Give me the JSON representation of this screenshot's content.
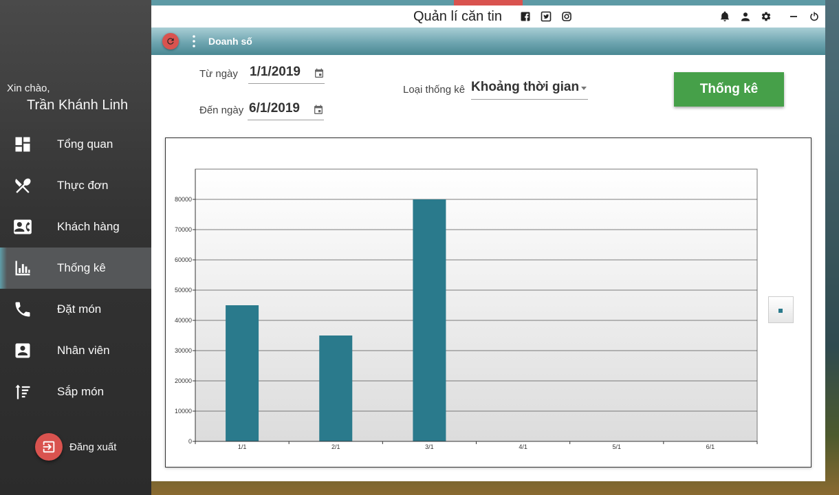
{
  "sidebar": {
    "greeting": "Xin chào,",
    "username": "Trần Khánh Linh",
    "items": [
      {
        "label": "Tổng quan",
        "icon": "dashboard-icon"
      },
      {
        "label": "Thực đơn",
        "icon": "restaurant-icon"
      },
      {
        "label": "Khách hàng",
        "icon": "contact-card-icon"
      },
      {
        "label": "Thống kê",
        "icon": "bar-chart-icon",
        "active": true
      },
      {
        "label": "Đặt món",
        "icon": "phone-icon"
      },
      {
        "label": "Nhân viên",
        "icon": "person-badge-icon"
      },
      {
        "label": "Sắp món",
        "icon": "sort-icon"
      }
    ],
    "logout_label": "Đăng xuất"
  },
  "titlebar": {
    "title": "Quản lí căn tin"
  },
  "toolbar": {
    "title": "Doanh số"
  },
  "form": {
    "from_label": "Từ ngày",
    "from_value": "1/1/2019",
    "to_label": "Đến ngày",
    "to_value": "6/1/2019",
    "type_label": "Loại thống kê",
    "type_value": "Khoảng thời gian",
    "submit_label": "Thống kê"
  },
  "colors": {
    "accent": "#d9534f",
    "bar": "#2a7a8c",
    "button": "#46a049"
  },
  "chart_data": {
    "type": "bar",
    "categories": [
      "1/1",
      "2/1",
      "3/1",
      "4/1",
      "5/1",
      "6/1"
    ],
    "values": [
      45000,
      35000,
      80000,
      0,
      0,
      0
    ],
    "yticks": [
      0,
      10000,
      20000,
      30000,
      40000,
      50000,
      60000,
      70000,
      80000
    ],
    "ylim": [
      0,
      90000
    ],
    "grid": true,
    "legend": "right"
  }
}
